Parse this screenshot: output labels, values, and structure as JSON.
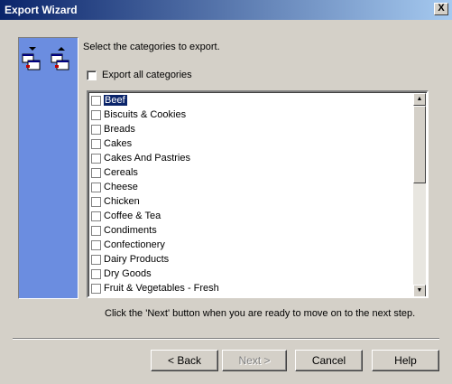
{
  "window": {
    "title": "Export Wizard",
    "close_glyph": "X"
  },
  "main": {
    "prompt": "Select the categories to export.",
    "export_all_label": "Export all categories",
    "categories": [
      "Beef",
      "Biscuits & Cookies",
      "Breads",
      "Cakes",
      "Cakes And Pastries",
      "Cereals",
      "Cheese",
      "Chicken",
      "Coffee & Tea",
      "Condiments",
      "Confectionery",
      "Dairy Products",
      "Dry Goods",
      "Fruit & Vegetables - Fresh"
    ],
    "hint": "Click the 'Next' button when you are ready to move on to the next step."
  },
  "buttons": {
    "back": "< Back",
    "next": "Next >",
    "cancel": "Cancel",
    "help": "Help"
  },
  "colors": {
    "side_panel": "#6b8de0",
    "selection": "#0a246a",
    "titlebar_start": "#0a246a",
    "titlebar_end": "#a6caf0"
  }
}
